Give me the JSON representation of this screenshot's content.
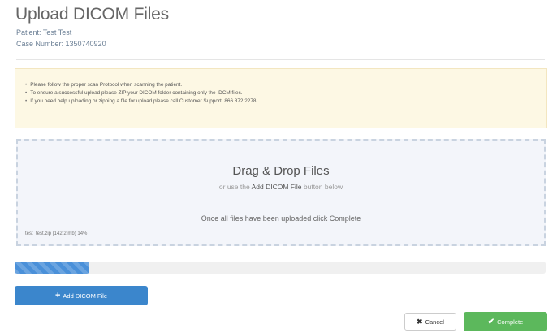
{
  "header": {
    "title": "Upload DICOM Files",
    "patient": "Patient: Test Test",
    "case_number": "Case Number: 1350740920"
  },
  "notice": {
    "items": [
      "Please follow the proper scan Protocol when scanning the patient.",
      "To ensure a successful upload please ZIP your DICOM folder containing only the .DCM files.",
      "If you need help uploading or zipping a file for upload please call Customer Support: 866 872 2278"
    ]
  },
  "dropzone": {
    "title": "Drag & Drop Files",
    "sub_prefix": "or use the",
    "sub_strong": "Add DICOM File",
    "sub_suffix": "button below",
    "complete_hint": "Once all files have been uploaded click Complete",
    "file_status": "test_test.zip (142.2 mb) 14%"
  },
  "progress": {
    "percent": 14,
    "color": "#4a90d9"
  },
  "buttons": {
    "add_label": "Add DICOM File",
    "cancel_label": "Cancel",
    "complete_label": "Complete"
  },
  "colors": {
    "primary": "#3b86cc",
    "success": "#5cb85c",
    "notice_bg": "#fdf8e4",
    "dropzone_bg": "#f3f5fa"
  },
  "icons": {
    "add": "plus-icon",
    "cancel": "close-icon",
    "complete": "check-icon"
  }
}
